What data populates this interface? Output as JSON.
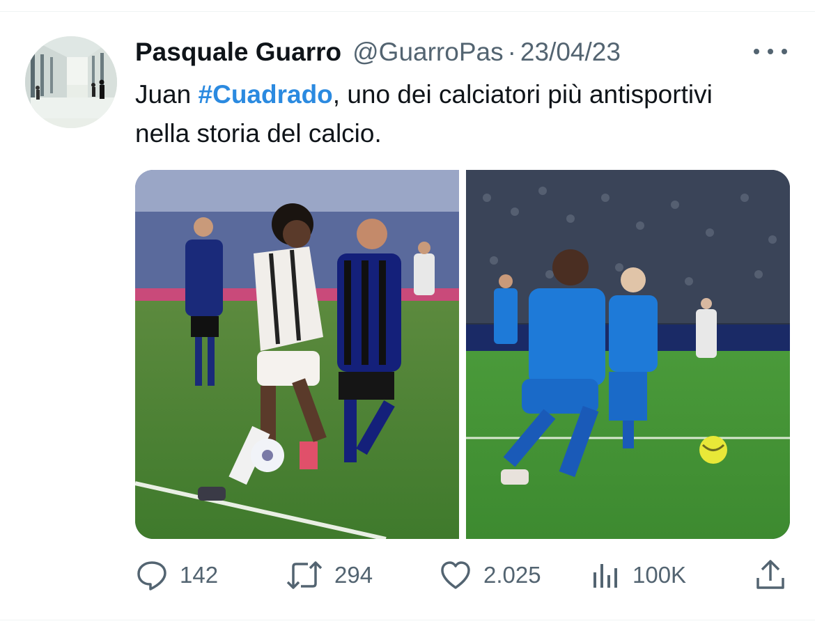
{
  "tweet": {
    "author_name": "Pasquale Guarro",
    "author_handle": "@GuarroPas",
    "separator": "·",
    "date": "23/04/23",
    "text_before": "Juan ",
    "hashtag": "#Cuadrado",
    "text_after": ", uno dei calciatori più antisportivi nella storia del calcio."
  },
  "media": {
    "images": [
      {
        "icon": "photo-juventus-inter"
      },
      {
        "icon": "photo-juventus-napoli"
      }
    ]
  },
  "actions": {
    "reply_count": "142",
    "retweet_count": "294",
    "like_count": "2.025",
    "views_count": "100K"
  },
  "colors": {
    "text": "#0f1419",
    "secondary": "#536471",
    "link": "#1d9bf0",
    "divider": "#eff3f4"
  }
}
